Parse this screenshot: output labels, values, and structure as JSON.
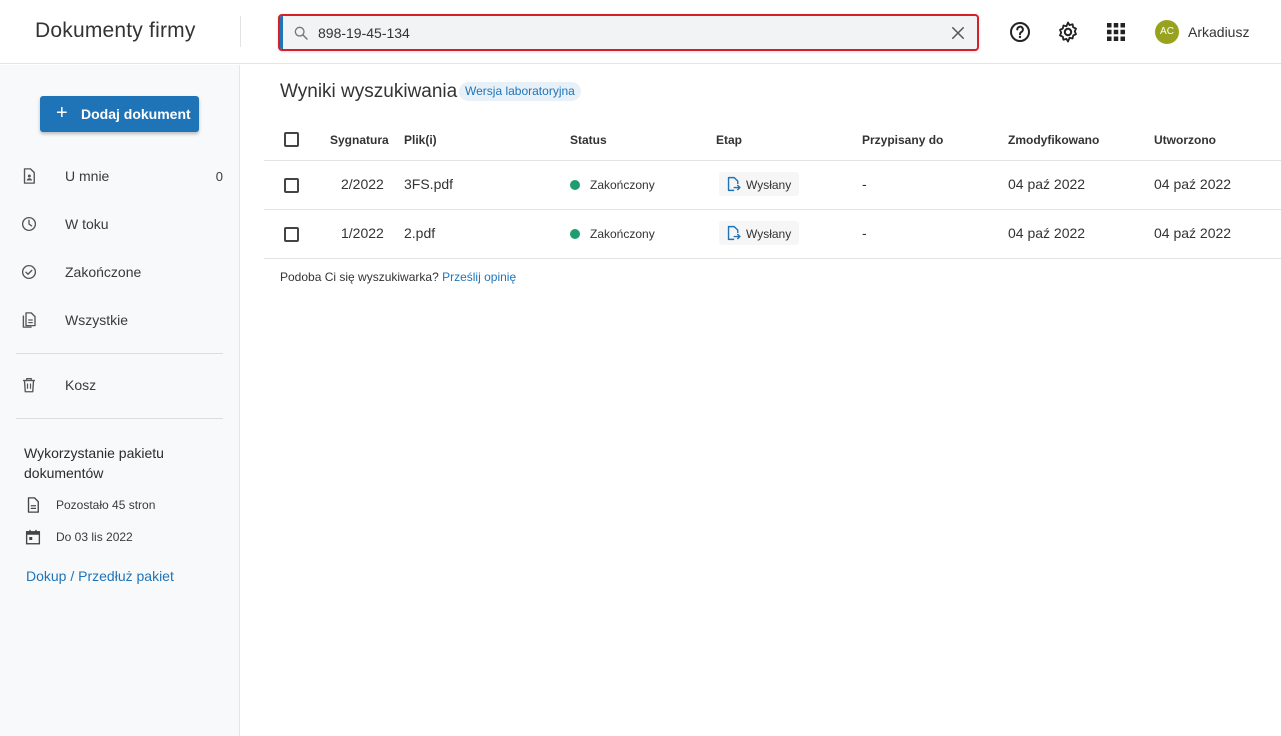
{
  "app": {
    "title": "Dokumenty firmy"
  },
  "search": {
    "value": "898-19-45-134",
    "placeholder": ""
  },
  "header_icons": [
    "help-circle-icon",
    "gear-icon",
    "apps-grid-icon"
  ],
  "user": {
    "initials": "AC",
    "name": "Arkadiusz",
    "avatar_color": "#97a31e"
  },
  "sidebar": {
    "add_button": "Dodaj dokument",
    "items": [
      {
        "label": "U mnie",
        "icon": "document-person-icon",
        "count": "0"
      },
      {
        "label": "W toku",
        "icon": "clock-icon",
        "count": ""
      },
      {
        "label": "Zakończone",
        "icon": "check-circle-icon",
        "count": ""
      },
      {
        "label": "Wszystkie",
        "icon": "documents-stack-icon",
        "count": ""
      },
      {
        "label": "Kosz",
        "icon": "trash-icon",
        "count": ""
      }
    ],
    "usage": {
      "title": "Wykorzystanie pakietu dokumentów",
      "pages_left": "Pozostało 45 stron",
      "valid_until": "Do 03 lis 2022",
      "extend_link": "Dokup / Przedłuż pakiet"
    }
  },
  "main": {
    "title": "Wyniki wyszukiwania",
    "badge": "Wersja laboratoryjna",
    "columns": [
      "Sygnatura",
      "Plik(i)",
      "Status",
      "Etap",
      "Przypisany do",
      "Zmodyfikowano",
      "Utworzono"
    ],
    "rows": [
      {
        "signature": "2/2022",
        "file": "3FS.pdf",
        "status": "Zakończony",
        "stage": "Wysłany",
        "assigned": "-",
        "modified": "04 paź 2022",
        "created": "04 paź 2022"
      },
      {
        "signature": "1/2022",
        "file": "2.pdf",
        "status": "Zakończony",
        "stage": "Wysłany",
        "assigned": "-",
        "modified": "04 paź 2022",
        "created": "04 paź 2022"
      }
    ],
    "feedback_text": "Podoba Ci się wyszukiwarka?",
    "feedback_link": "Prześlij opinię"
  },
  "colors": {
    "primary": "#1f74b8",
    "search_border": "#d5202b",
    "status_done": "#1e9e6e"
  }
}
